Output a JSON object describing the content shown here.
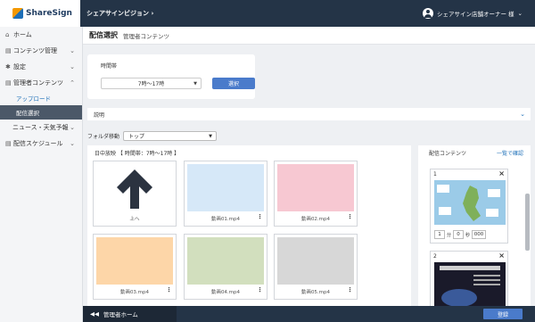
{
  "app": {
    "logo_text": "ShareSign",
    "vision_label": "シェアサインビジョン",
    "vision_chevron": "›",
    "user_name": "シェアサイン店舗オーナー 様",
    "user_chevron": "⌄"
  },
  "sidebar": {
    "items": [
      {
        "label": "ホーム",
        "icon": "home-icon",
        "glyph": "⌂"
      },
      {
        "label": "コンテンツ管理",
        "icon": "document-icon",
        "glyph": "▤",
        "chevron": "⌄"
      },
      {
        "label": "設定",
        "icon": "gear-icon",
        "glyph": "✱",
        "chevron": "⌄"
      },
      {
        "label": "管理者コンテンツ",
        "icon": "document-icon",
        "glyph": "▤",
        "chevron": "⌃"
      }
    ],
    "sub_items": [
      {
        "label": "アップロード"
      },
      {
        "label": "配信選択"
      }
    ],
    "items_after": [
      {
        "label": "ニュース・天気予報",
        "chevron": "⌄"
      },
      {
        "label": "配信スケジュール",
        "icon": "document-icon",
        "glyph": "▤",
        "chevron": "⌄"
      }
    ]
  },
  "page": {
    "title": "配信選択",
    "subtitle": "管理者コンテンツ"
  },
  "time_card": {
    "label": "時間帯",
    "selected": "7時〜17時",
    "button": "選択"
  },
  "description": {
    "label": "説明"
  },
  "folder": {
    "label": "フォルダ移動",
    "selected": "トップ"
  },
  "content": {
    "header": "日中放映 【 時間帯：7時〜17時 】",
    "tiles": [
      {
        "name": "上へ",
        "color": "#ffffff"
      },
      {
        "name": "動画01.mp4",
        "color": "#d6e8f8"
      },
      {
        "name": "動画02.mp4",
        "color": "#f7c8d2"
      },
      {
        "name": "動画03.mp4",
        "color": "#fdd6a8"
      },
      {
        "name": "動画04.mp4",
        "color": "#d2dfbe"
      },
      {
        "name": "動画05.mp4",
        "color": "#d7d7d7"
      }
    ]
  },
  "delivery": {
    "title": "配信コンテンツ",
    "link": "一覧で確認",
    "cards": [
      {
        "number": "1",
        "minutes": "1",
        "min_unit": "分",
        "seconds": "0",
        "sec_unit": "秒",
        "frames": "000"
      },
      {
        "number": "2"
      }
    ]
  },
  "footer": {
    "back_label": "管理者ホーム",
    "register": "登録"
  }
}
